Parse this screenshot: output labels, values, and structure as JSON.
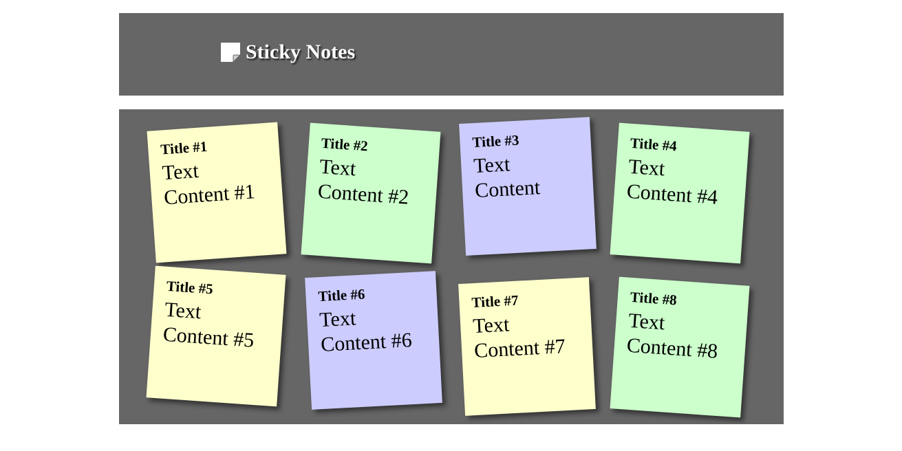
{
  "header": {
    "title": "Sticky Notes",
    "icon": "sticky-note-icon",
    "background": "#666666"
  },
  "board": {
    "background": "#666666"
  },
  "notes": [
    {
      "title": "Title #1",
      "body": "Text Content #1",
      "color": "#ffffcc"
    },
    {
      "title": "Title #2",
      "body": "Text Content #2",
      "color": "#ccffcc"
    },
    {
      "title": "Title #3",
      "body": "Text Content",
      "color": "#ccccff"
    },
    {
      "title": "Title #4",
      "body": "Text Content #4",
      "color": "#ccffcc"
    },
    {
      "title": "Title #5",
      "body": "Text Content #5",
      "color": "#ffffcc"
    },
    {
      "title": "Title #6",
      "body": "Text Content #6",
      "color": "#ccccff"
    },
    {
      "title": "Title #7",
      "body": "Text Content #7",
      "color": "#ffffcc"
    },
    {
      "title": "Title #8",
      "body": "Text Content #8",
      "color": "#ccffcc"
    }
  ]
}
